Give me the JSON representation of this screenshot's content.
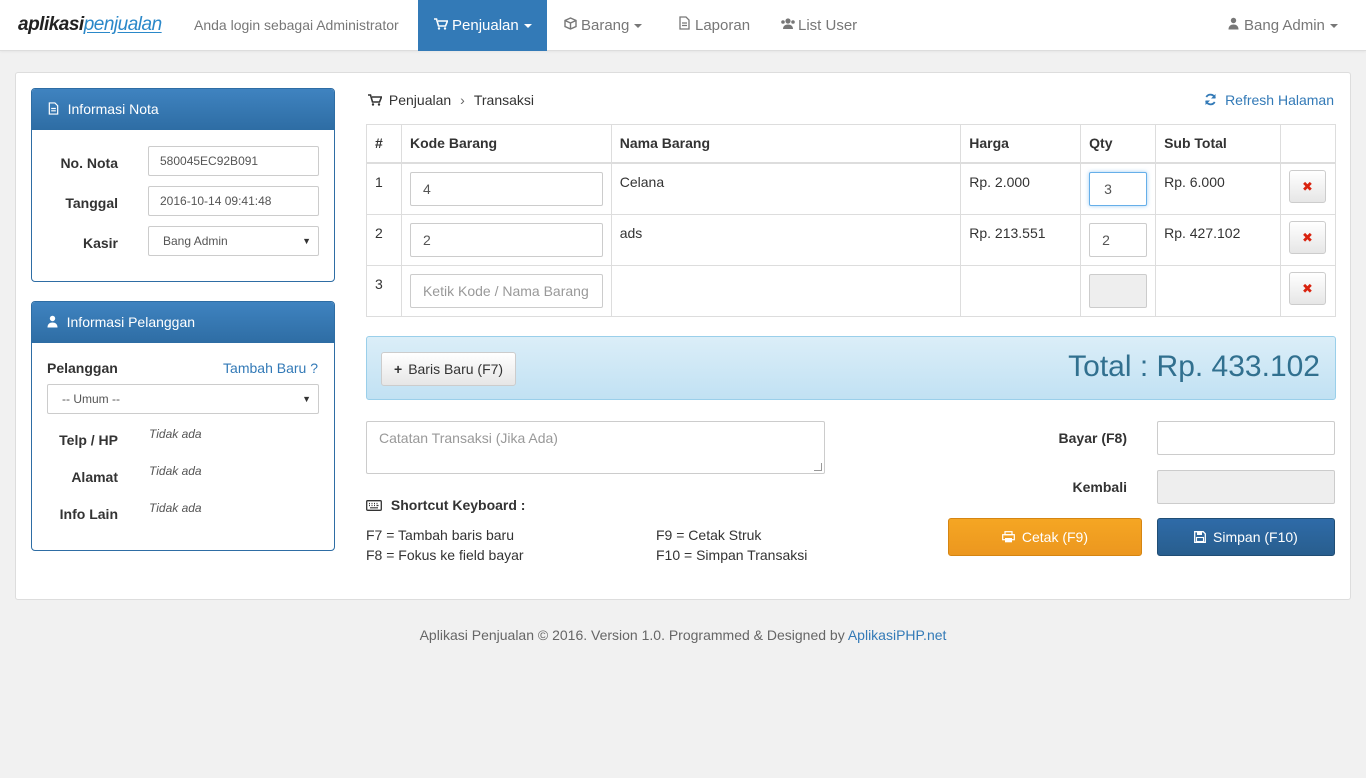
{
  "navbar": {
    "brand_part1": "aplikasi",
    "brand_part2": "penjualan",
    "login_text": "Anda login sebagai Administrator",
    "menu": {
      "penjualan": "Penjualan",
      "barang": "Barang",
      "laporan": "Laporan",
      "list_user": "List User"
    },
    "user": "Bang Admin"
  },
  "nota": {
    "title": "Informasi Nota",
    "no_nota_label": "No. Nota",
    "no_nota_value": "580045EC92B091",
    "tanggal_label": "Tanggal",
    "tanggal_value": "2016-10-14 09:41:48",
    "kasir_label": "Kasir",
    "kasir_value": "Bang Admin"
  },
  "pelanggan": {
    "title": "Informasi Pelanggan",
    "label": "Pelanggan",
    "tambah_baru": "Tambah Baru ?",
    "select_value": "-- Umum --",
    "telp_label": "Telp / HP",
    "telp_value": "Tidak ada",
    "alamat_label": "Alamat",
    "alamat_value": "Tidak ada",
    "info_label": "Info Lain",
    "info_value": "Tidak ada"
  },
  "breadcrumb": {
    "item1": "Penjualan",
    "separator": "›",
    "item2": "Transaksi"
  },
  "refresh_label": "Refresh Halaman",
  "table": {
    "headers": [
      "#",
      "Kode Barang",
      "Nama Barang",
      "Harga",
      "Qty",
      "Sub Total",
      ""
    ],
    "rows": [
      {
        "no": "1",
        "kode": "4",
        "nama": "Celana",
        "harga": "Rp. 2.000",
        "qty": "3",
        "subtotal": "Rp. 6.000"
      },
      {
        "no": "2",
        "kode": "2",
        "nama": "ads",
        "harga": "Rp. 213.551",
        "qty": "2",
        "subtotal": "Rp. 427.102"
      },
      {
        "no": "3",
        "kode_placeholder": "Ketik Kode / Nama Barang",
        "nama": "",
        "harga": "",
        "qty": "",
        "subtotal": ""
      }
    ],
    "delete_symbol": "✖"
  },
  "total": {
    "baris_baru": "Baris Baru (F7)",
    "total_text": "Total : Rp. 433.102"
  },
  "catatan_placeholder": "Catatan Transaksi (Jika Ada)",
  "shortcut": {
    "title": "Shortcut Keyboard :",
    "f7": "F7 = Tambah baris baru",
    "f8": "F8 = Fokus ke field bayar",
    "f9": "F9 = Cetak Struk",
    "f10": "F10 = Simpan Transaksi"
  },
  "payment": {
    "bayar_label": "Bayar (F8)",
    "kembali_label": "Kembali",
    "cetak_button": "Cetak (F9)",
    "simpan_button": "Simpan (F10)"
  },
  "footer": {
    "text": "Aplikasi Penjualan © 2016. Version 1.0. Programmed & Designed by ",
    "link": "AplikasiPHP.net"
  },
  "colors": {
    "primary": "#337ab7",
    "warning": "#ec971f",
    "danger": "#d9230f",
    "info_bg": "#c1e1f3"
  }
}
